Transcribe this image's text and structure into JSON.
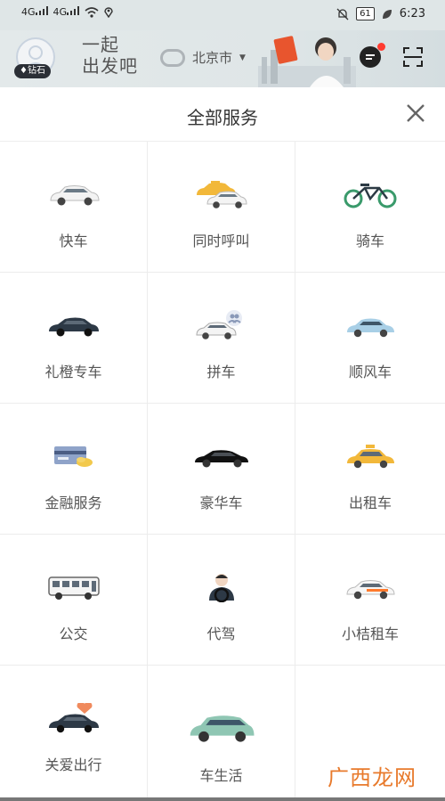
{
  "status_bar": {
    "net1": "4G",
    "net2": "4G",
    "battery": "61",
    "time": "6:23"
  },
  "banner": {
    "badge": "钻石",
    "slogan_line1": "一起",
    "slogan_line2": "出发吧",
    "city": "北京市"
  },
  "header": {
    "title": "全部服务"
  },
  "services": [
    {
      "label": "快车",
      "icon": "car-icon"
    },
    {
      "label": "同时呼叫",
      "icon": "multi-car-icon"
    },
    {
      "label": "骑车",
      "icon": "bicycle-icon"
    },
    {
      "label": "礼橙专车",
      "icon": "premier-car-icon"
    },
    {
      "label": "拼车",
      "icon": "carpool-icon"
    },
    {
      "label": "顺风车",
      "icon": "hitch-car-icon"
    },
    {
      "label": "金融服务",
      "icon": "finance-card-icon"
    },
    {
      "label": "豪华车",
      "icon": "luxury-car-icon"
    },
    {
      "label": "出租车",
      "icon": "taxi-icon"
    },
    {
      "label": "公交",
      "icon": "bus-icon"
    },
    {
      "label": "代驾",
      "icon": "designated-driver-icon"
    },
    {
      "label": "小桔租车",
      "icon": "rental-car-icon"
    },
    {
      "label": "关爱出行",
      "icon": "care-trip-icon"
    },
    {
      "label": "车生活",
      "icon": "car-life-icon"
    }
  ],
  "watermark": "广西龙网",
  "colors": {
    "accent_orange": "#ff7a2c",
    "taxi_yellow": "#f2b83a",
    "hitch_blue": "#a8cfe6",
    "green": "#3a9a6b"
  }
}
